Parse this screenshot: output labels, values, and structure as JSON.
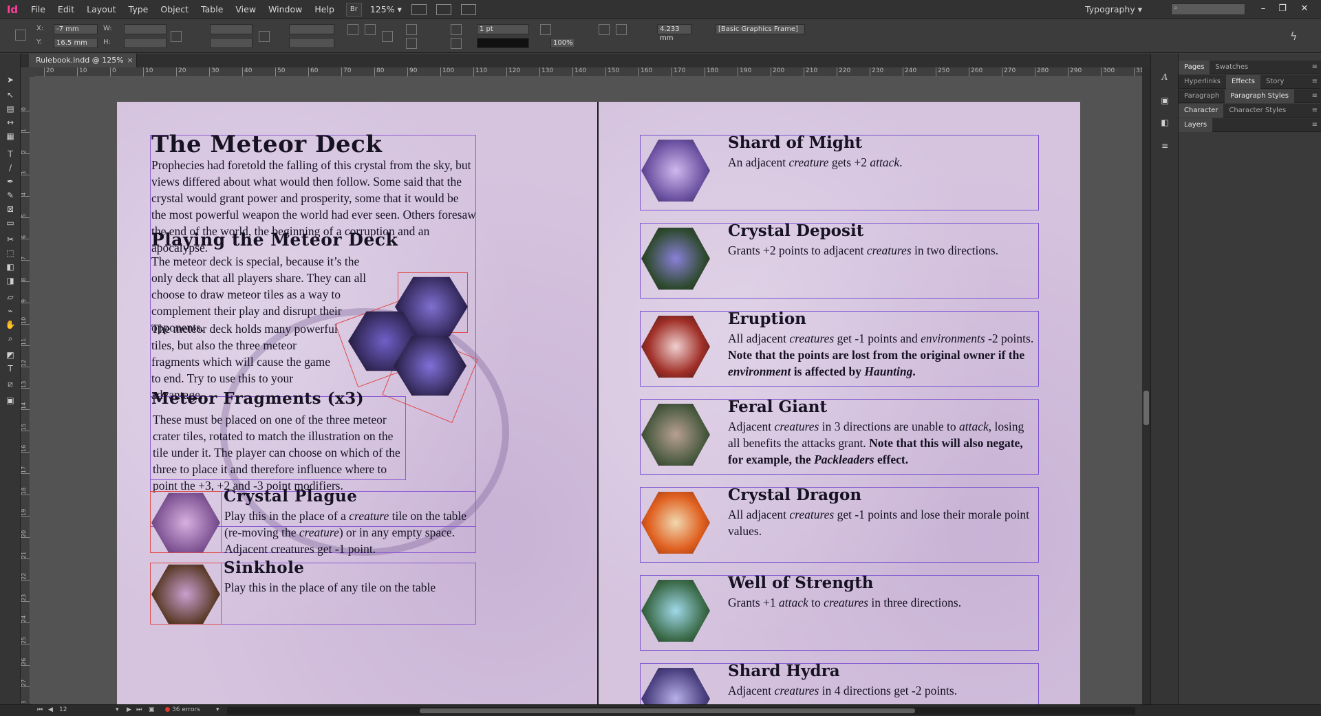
{
  "app": {
    "logo": "Id",
    "menu": [
      "File",
      "Edit",
      "Layout",
      "Type",
      "Object",
      "Table",
      "View",
      "Window",
      "Help"
    ],
    "br_label": "Br",
    "zoom": "125%",
    "workspace": "Typography",
    "window_controls": [
      "–",
      "❐",
      "✕"
    ]
  },
  "control_bar": {
    "x_label": "X:",
    "x_value": "-7 mm",
    "y_label": "Y:",
    "y_value": "16.5 mm",
    "w_label": "W:",
    "h_label": "H:",
    "stroke_weight": "1 pt",
    "scale_percent": "100%",
    "gutter_value": "4.233 mm",
    "object_style": "[Basic Graphics Frame]"
  },
  "document": {
    "tab_title": "Rulebook.indd @ 125%",
    "close_glyph": "×"
  },
  "ruler_top_ticks": [
    "20",
    "10",
    "0",
    "10",
    "20",
    "30",
    "40",
    "50",
    "60",
    "70",
    "80",
    "90",
    "100",
    "110",
    "120",
    "130",
    "140",
    "150",
    "160",
    "170",
    "180",
    "190",
    "200",
    "210",
    "220",
    "230",
    "240",
    "250",
    "260",
    "270",
    "280",
    "290",
    "300",
    "310"
  ],
  "ruler_left_ticks": [
    "0",
    "1",
    "2",
    "3",
    "4",
    "5",
    "6",
    "7",
    "8",
    "9",
    "10",
    "11",
    "12",
    "13",
    "14",
    "15",
    "16",
    "17",
    "18",
    "19",
    "20",
    "21",
    "22",
    "23",
    "24",
    "25",
    "26",
    "27",
    "28",
    "29"
  ],
  "left_page": {
    "title": "The Meteor Deck",
    "intro": "Prophecies had foretold the falling of this crystal from the sky, but views differed about what would then follow. Some said that the crystal would grant power and prosperity, some that it would be the most powerful weapon the world had ever seen. Others foresaw the end of the world, the beginning of a corruption and an apocalypse.",
    "playing_heading": "Playing the Meteor Deck",
    "playing_p1": "The meteor deck is special, because it’s the only deck that all players share. They can all choose to draw meteor tiles as a way to complement their play and disrupt their opponents.",
    "playing_p2": "The meteor deck holds many powerful tiles, but also the three meteor fragments which will cause the game to end. Try to use this to your advantage.",
    "fragments_heading": "Meteor Fragments (x3)",
    "fragments_text": "These must be placed on one of the three meteor crater tiles, rotated to match the illustration on the tile under it. The player can choose on which of the three to place it and therefore influence where to point the +3, +2 and -3 point modifiers.",
    "plague_heading": "Crystal Plague",
    "plague_text_a": "Play this in the place of a ",
    "plague_text_creature": "creature",
    "plague_text_b": " tile on the table (re-moving the ",
    "plague_text_c": ") or in any empty space. Adjacent creatures get -1 point.",
    "sinkhole_heading": "Sinkhole",
    "sinkhole_text": "Play this in the place of any tile on the table"
  },
  "right_page": {
    "cards": [
      {
        "title": "Shard of Might",
        "pre": "An adjacent ",
        "italic": "creature",
        "post": " gets +2 ",
        "italic2": "attack",
        "end": "."
      },
      {
        "title": "Crystal Deposit",
        "pre": "Grants +2 points to adjacent ",
        "italic": "creatures",
        "post": " in two directions.",
        "italic2": "",
        "end": ""
      },
      {
        "title": "Eruption",
        "pre": "All adjacent ",
        "italic": "creatures",
        "post": " get -1 points and ",
        "italic2": "environments",
        "end": " -2 points. ",
        "bold": "Note that the points are lost from the original owner if the ",
        "bold_italic": "environment",
        "bold_end": " is affected by ",
        "bold_italic2": "Haunting",
        "bold_tail": "."
      },
      {
        "title": "Feral Giant",
        "pre": "Adjacent ",
        "italic": "creatures",
        "post": " in 3 directions are unable to ",
        "italic2": "attack",
        "end": ", losing all benefits the attacks grant. ",
        "bold": "Note that this will also negate, for example, the ",
        "bold_italic": "Packleaders",
        "bold_end": " effect.",
        "bold_italic2": "",
        "bold_tail": ""
      },
      {
        "title": "Crystal Dragon",
        "pre": "All adjacent ",
        "italic": "creatures",
        "post": " get -1 points and lose their morale point values.",
        "italic2": "",
        "end": ""
      },
      {
        "title": "Well of Strength",
        "pre": "Grants +1 ",
        "italic": "attack",
        "post": " to ",
        "italic2": "creatures",
        "end": " in three directions."
      },
      {
        "title": "Shard Hydra",
        "pre": "Adjacent ",
        "italic": "creatures",
        "post": " in 4 directions get -2 points.",
        "italic2": "",
        "end": ""
      }
    ]
  },
  "panels": {
    "row1": [
      "Pages",
      "Swatches"
    ],
    "row2": [
      "Hyperlinks",
      "Effects",
      "Story"
    ],
    "row3": [
      "Paragraph",
      "Paragraph Styles"
    ],
    "row4": [
      "Character",
      "Character Styles"
    ],
    "row5": [
      "Layers"
    ]
  },
  "status": {
    "page_number": "12",
    "errors": "36 errors"
  },
  "colors": {
    "page_bg": "#d6c4df",
    "frame": "#8d5bd3",
    "text": "#161222",
    "error": "#e0392f",
    "logo": "#ff3d9b"
  }
}
